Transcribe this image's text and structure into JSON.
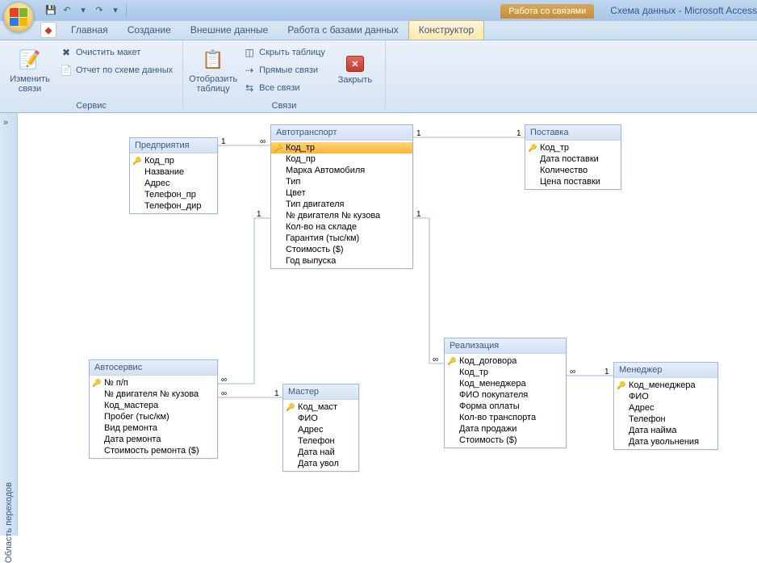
{
  "titlebar": {
    "context_tab": "Работа со связями",
    "title": "Схема данных - Microsoft Access"
  },
  "qat": {
    "save_tip": "Сохранить",
    "undo_tip": "Отменить",
    "redo_tip": "Повторить"
  },
  "tabs": {
    "ext_addon": "",
    "home": "Главная",
    "create": "Создание",
    "external": "Внешние данные",
    "db_tools": "Работа с базами данных",
    "design": "Конструктор"
  },
  "ribbon": {
    "edit_relations": "Изменить связи",
    "clear_layout": "Очистить макет",
    "report": "Отчет по схеме данных",
    "group_service": "Сервис",
    "show_table": "Отобразить таблицу",
    "hide_table": "Скрыть таблицу",
    "direct_rel": "Прямые связи",
    "all_rel": "Все связи",
    "group_relations": "Связи",
    "close": "Закрыть"
  },
  "nav_pane": {
    "label": "Область переходов"
  },
  "tables": {
    "enterprise": {
      "title": "Предприятия",
      "fields": [
        "Код_пр",
        "Название",
        "Адрес",
        "Телефон_пр",
        "Телефон_дир"
      ],
      "pk": [
        0
      ]
    },
    "auto": {
      "title": "Автотранспорт",
      "fields": [
        "Код_тр",
        "Код_пр",
        "Марка Автомобиля",
        "Тип",
        "Цвет",
        "Тип двигателя",
        "№ двигателя № кузова",
        "Кол-во на складе",
        "Гарантия  (тыс/км)",
        "Стоимость ($)",
        "Год выпуска"
      ],
      "pk": [
        0
      ]
    },
    "delivery": {
      "title": "Поставка",
      "fields": [
        "Код_тр",
        "Дата поставки",
        "Количество",
        "Цена поставки"
      ],
      "pk": [
        0
      ]
    },
    "service": {
      "title": "Автосервис",
      "fields": [
        "№ п/п",
        "№ двигателя № кузова",
        "Код_мастера",
        "Пробег (тыс/км)",
        "Вид ремонта",
        "Дата ремонта",
        "Стоимость ремонта ($)"
      ],
      "pk": [
        0
      ]
    },
    "master": {
      "title": "Мастер",
      "fields": [
        "Код_маст",
        "ФИО",
        "Адрес",
        "Телефон",
        "Дата най",
        "Дата увол"
      ],
      "pk": [
        0
      ]
    },
    "sale": {
      "title": "Реализация",
      "fields": [
        "Код_договора",
        "Код_тр",
        "Код_менеджера",
        "ФИО покупателя",
        "Форма оплаты",
        "Кол-во транспорта",
        "Дата продажи",
        "Стоимость ($)"
      ],
      "pk": [
        0
      ]
    },
    "manager": {
      "title": "Менеджер",
      "fields": [
        "Код_менеджера",
        "ФИО",
        "Адрес",
        "Телефон",
        "Дата найма",
        "Дата увольнения"
      ],
      "pk": [
        0
      ]
    }
  },
  "rel_labels": {
    "one": "1",
    "many": "∞"
  }
}
